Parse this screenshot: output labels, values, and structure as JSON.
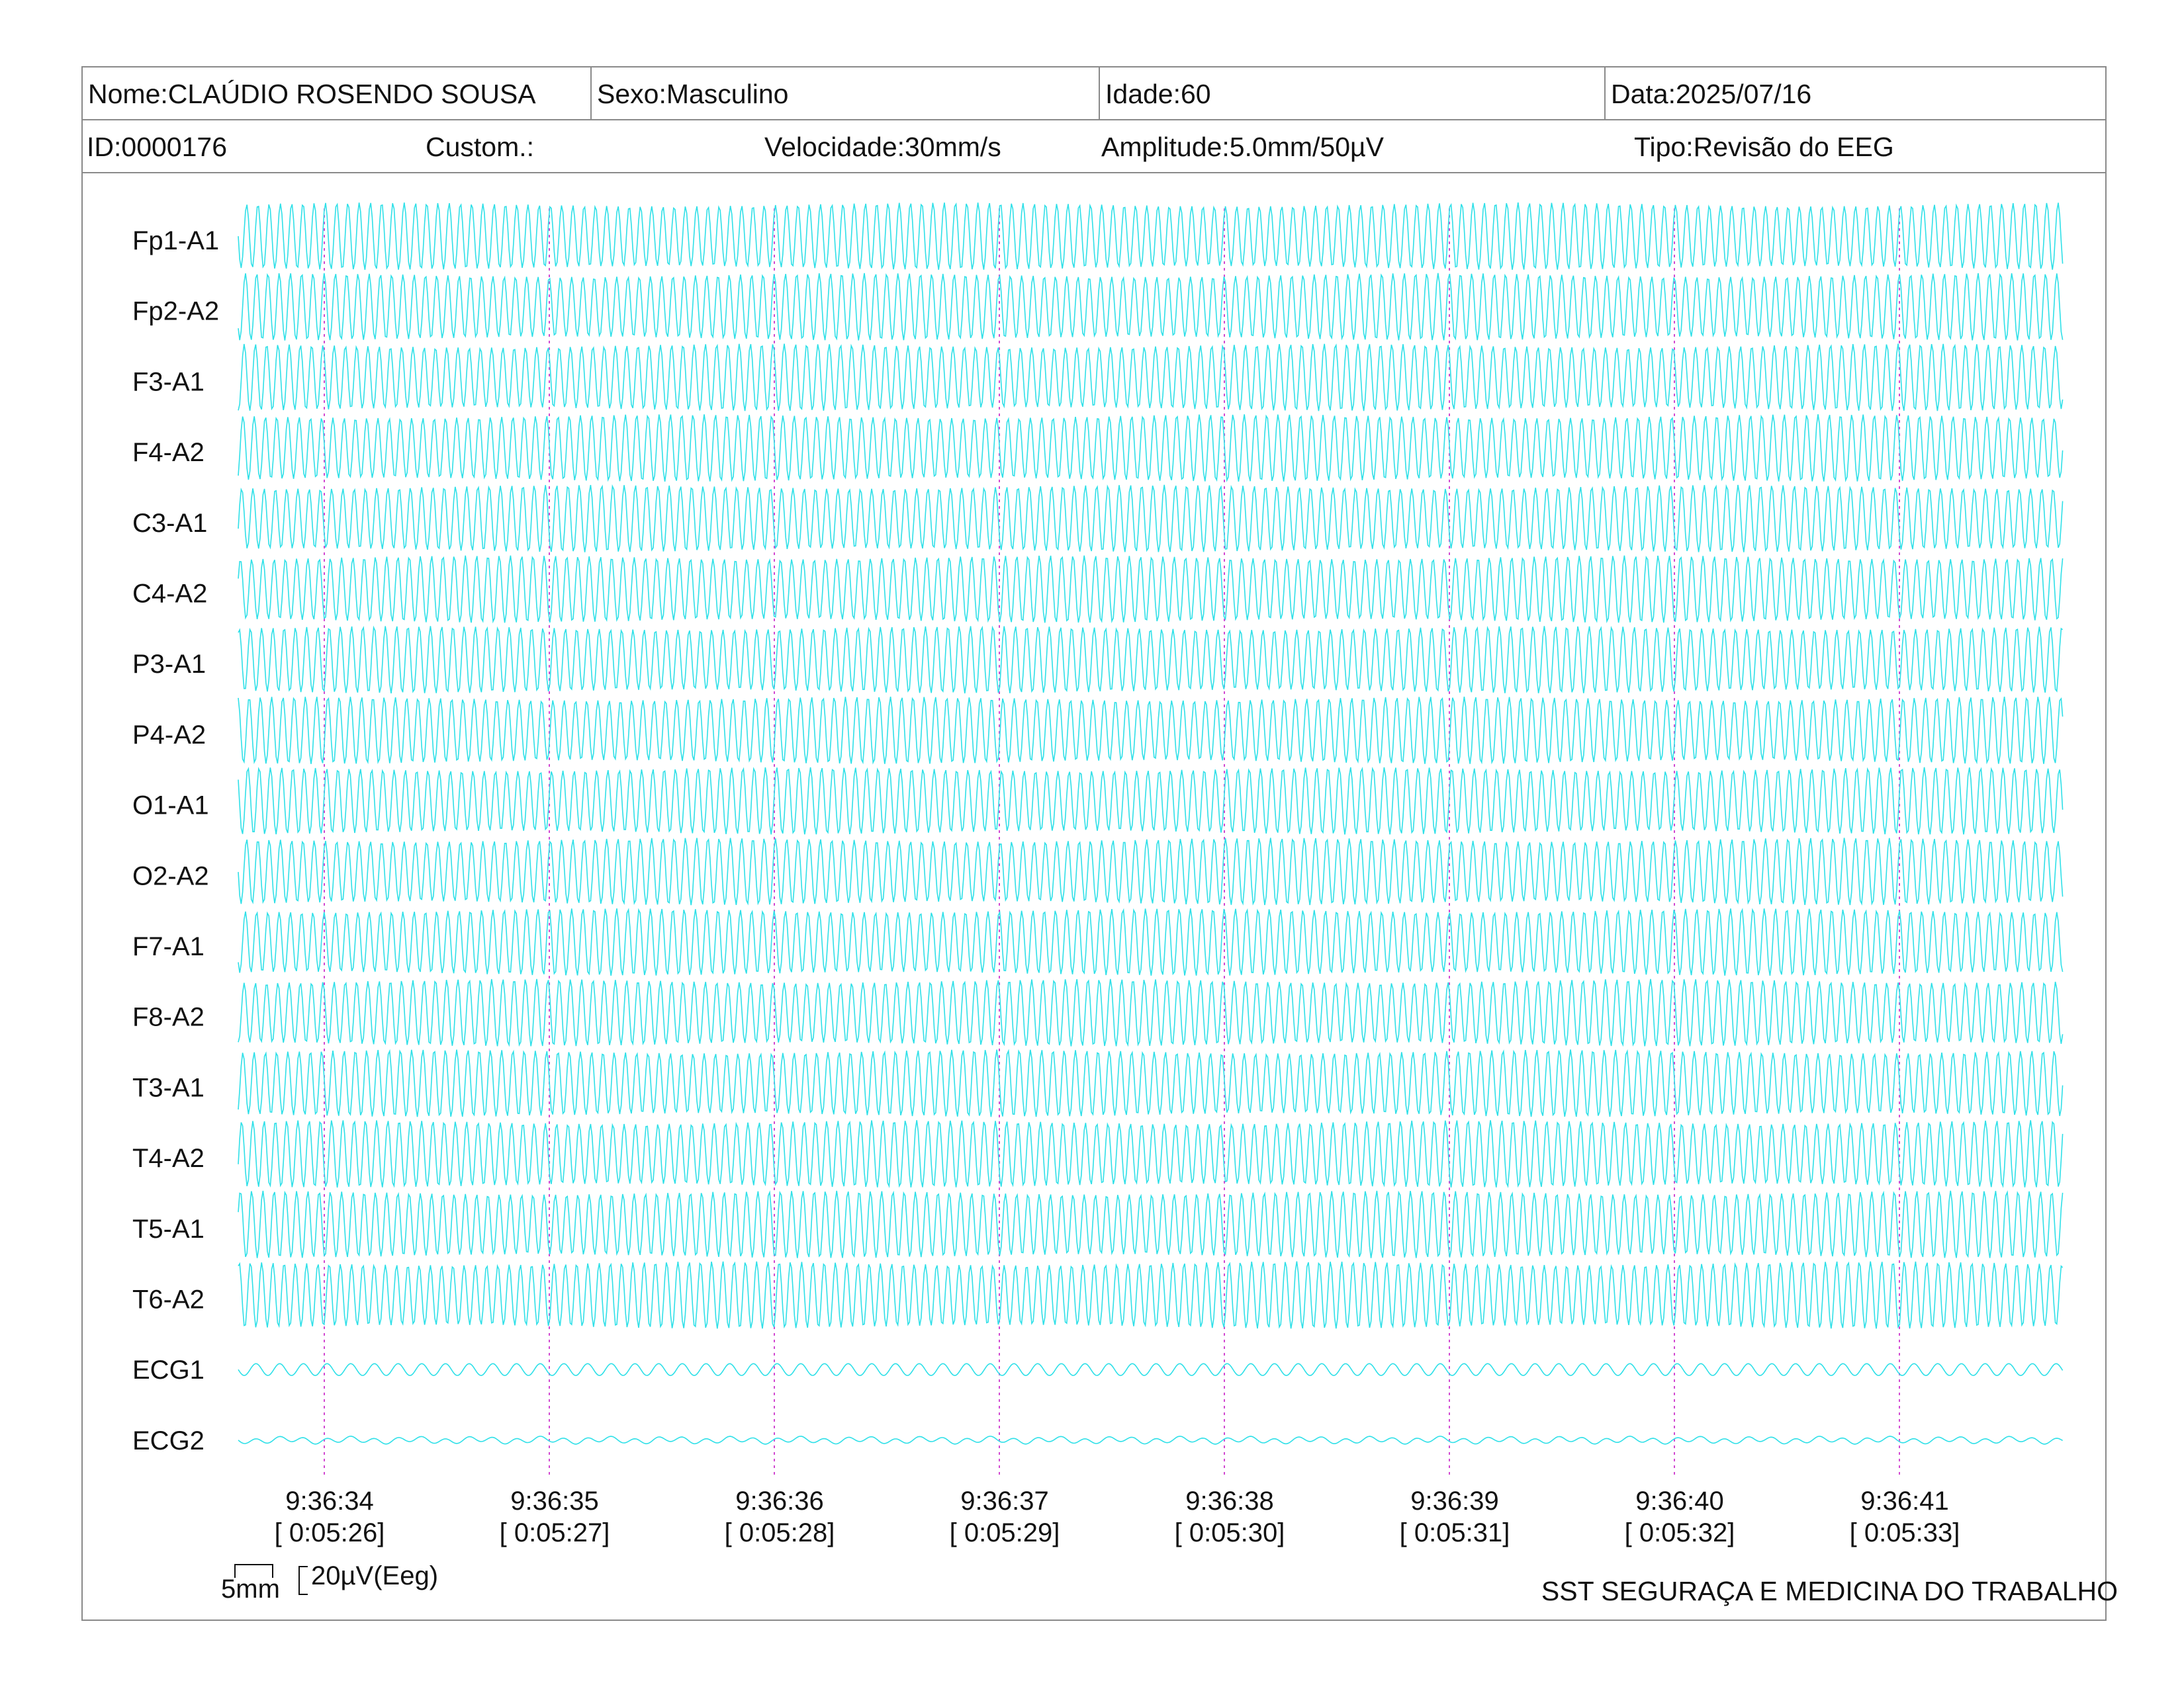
{
  "header": {
    "name": "Nome:CLAÚDIO ROSENDO SOUSA",
    "sex": "Sexo:Masculino",
    "age": "Idade:60",
    "date": "Data:2025/07/16",
    "id": "ID:0000176",
    "custom": "Custom.:",
    "speed": "Velocidade:30mm/s",
    "amplitude": "Amplitude:5.0mm/50µV",
    "type": "Tipo:Revisão do EEG"
  },
  "scale": {
    "mm_label": "5mm",
    "uv_label": "20µV(Eeg)"
  },
  "footer": {
    "organization": "SST SEGURAÇA E MEDICINA DO TRABALHO"
  },
  "colors": {
    "trace": "#2fe0e8",
    "time_marker": "#d24bd2",
    "border": "#8a8a8a"
  },
  "chart_data": {
    "type": "line",
    "title": "",
    "channels": [
      "Fp1-A1",
      "Fp2-A2",
      "F3-A1",
      "F4-A2",
      "C3-A1",
      "C4-A2",
      "P3-A1",
      "P4-A2",
      "O1-A1",
      "O2-A2",
      "F7-A1",
      "F8-A2",
      "T3-A1",
      "T4-A2",
      "T5-A1",
      "T6-A2",
      "ECG1",
      "ECG2"
    ],
    "time_marks": [
      {
        "clock": "9:36:34",
        "elapsed": "[ 0:05:26]"
      },
      {
        "clock": "9:36:35",
        "elapsed": "[ 0:05:27]"
      },
      {
        "clock": "9:36:36",
        "elapsed": "[ 0:05:28]"
      },
      {
        "clock": "9:36:37",
        "elapsed": "[ 0:05:29]"
      },
      {
        "clock": "9:36:38",
        "elapsed": "[ 0:05:30]"
      },
      {
        "clock": "9:36:39",
        "elapsed": "[ 0:05:31]"
      },
      {
        "clock": "9:36:40",
        "elapsed": "[ 0:05:32]"
      },
      {
        "clock": "9:36:41",
        "elapsed": "[ 0:05:33]"
      }
    ],
    "seconds_shown": 8.1,
    "eeg_cycles_per_second": 20,
    "ecg_cycles_per_second": 9.5,
    "grid": false
  }
}
